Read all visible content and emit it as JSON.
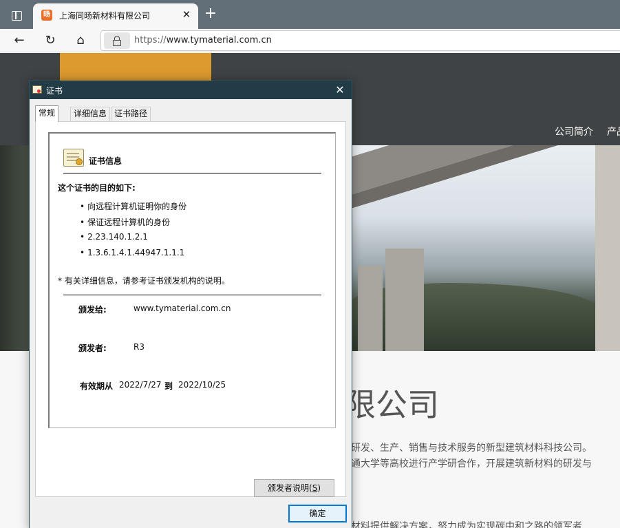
{
  "browser": {
    "tab_title": "上海同旸新材料有限公司",
    "favicon_text": "旸",
    "url_scheme": "https://",
    "url_host": "www.tymaterial.com.cn"
  },
  "page": {
    "nav": [
      "公司简介",
      "产品"
    ],
    "company_title": "限公司",
    "company_lines": [
      "研发、生产、销售与技术服务的新型建筑材料科技公司。",
      "通大学等高校进行产学研合作，开展建筑新材料的研发与",
      "材料提供解决方案，努力成为实现碳中和之路的领军者"
    ],
    "colors": {
      "header": "#3f4345",
      "logo": "#dd9a2e"
    }
  },
  "dialog": {
    "title": "证书",
    "tabs": [
      "常规",
      "详细信息",
      "证书路径"
    ],
    "cert_info_title": "证书信息",
    "purpose_heading": "这个证书的目的如下:",
    "purposes": [
      "向远程计算机证明你的身份",
      "保证远程计算机的身份",
      "2.23.140.1.2.1",
      "1.3.6.1.4.1.44947.1.1.1"
    ],
    "footnote": "* 有关详细信息，请参考证书颁发机构的说明。",
    "issued_to_label": "颁发给:",
    "issued_to_value": "www.tymaterial.com.cn",
    "issued_by_label": "颁发者:",
    "issued_by_value": "R3",
    "valid_label": "有效期从",
    "valid_from": "2022/7/27",
    "valid_to_label": "到",
    "valid_to": "2022/10/25",
    "issuer_button": "颁发者说明(",
    "issuer_button_key": "S",
    "issuer_button_end": ")",
    "ok_button": "确定"
  }
}
